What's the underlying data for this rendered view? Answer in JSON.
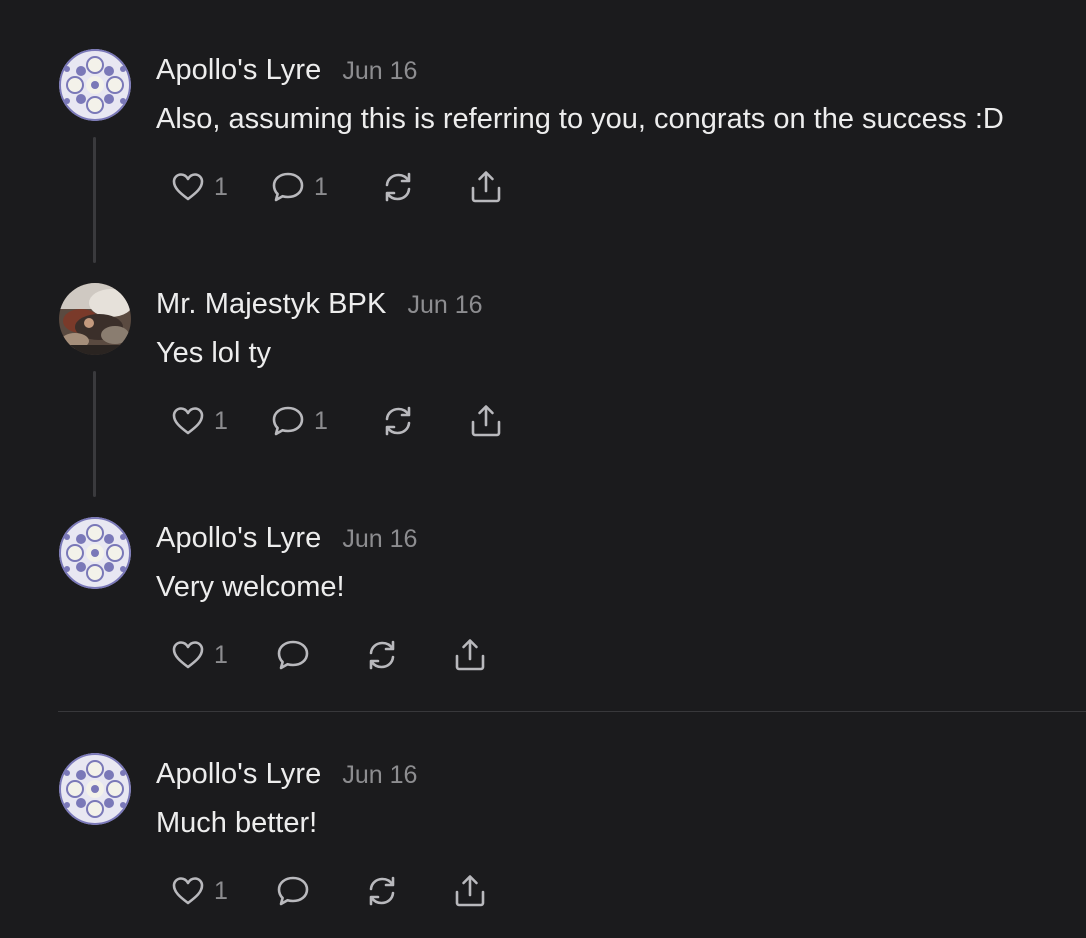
{
  "comments": [
    {
      "author": "Apollo's Lyre",
      "date": "Jun 16",
      "text": "Also, assuming this is referring to you, congrats on the success :D",
      "avatar": "fractal-avatar",
      "likes": "1",
      "replies": "1"
    },
    {
      "author": "Mr. Majestyk BPK",
      "date": "Jun 16",
      "text": "Yes lol ty",
      "avatar": "photo-avatar",
      "likes": "1",
      "replies": "1"
    },
    {
      "author": "Apollo's Lyre",
      "date": "Jun 16",
      "text": "Very welcome!",
      "avatar": "fractal-avatar",
      "likes": "1",
      "replies": ""
    },
    {
      "author": "Apollo's Lyre",
      "date": "Jun 16",
      "text": "Much better!",
      "avatar": "fractal-avatar",
      "likes": "1",
      "replies": ""
    }
  ],
  "icons": {
    "like": "heart-icon",
    "reply": "comment-bubble-icon",
    "restack": "restack-icon",
    "share": "share-icon"
  },
  "colors": {
    "background": "#1b1b1d",
    "text": "#ededed",
    "muted": "#8d8d90",
    "icon": "#b9b9bd",
    "thread_line": "#3a3a3d",
    "avatar_fractal": "#7a78b8"
  }
}
